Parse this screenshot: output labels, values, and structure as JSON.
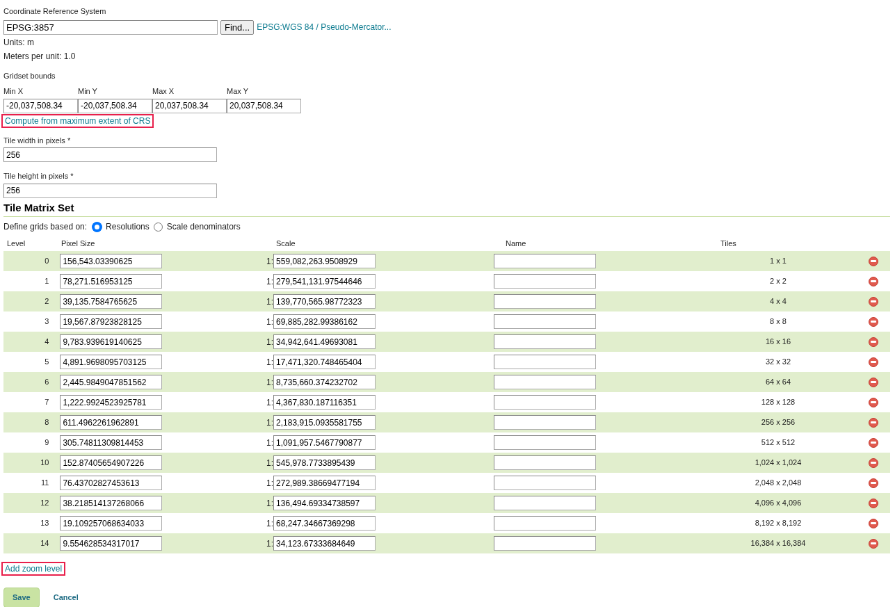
{
  "crs": {
    "label": "Coordinate Reference System",
    "value": "EPSG:3857",
    "find_button": "Find...",
    "crs_link": "EPSG:WGS 84 / Pseudo-Mercator...",
    "units": "Units: m",
    "meters_per_unit": "Meters per unit: 1.0"
  },
  "bounds": {
    "label": "Gridset bounds",
    "fields": [
      {
        "label": "Min X",
        "value": "-20,037,508.34"
      },
      {
        "label": "Min Y",
        "value": "-20,037,508.34"
      },
      {
        "label": "Max X",
        "value": "20,037,508.34"
      },
      {
        "label": "Max Y",
        "value": "20,037,508.34"
      }
    ],
    "compute_link": {
      "text": "Compute from maximum extent of CRS",
      "highlighted": true
    }
  },
  "tile_width": {
    "label": "Tile width in pixels *",
    "value": "256"
  },
  "tile_height": {
    "label": "Tile height in pixels *",
    "value": "256"
  },
  "matrix": {
    "title": "Tile Matrix Set",
    "define_label": "Define grids based on:",
    "options": [
      {
        "label": "Resolutions",
        "selected": true
      },
      {
        "label": "Scale denominators",
        "selected": false
      }
    ],
    "columns": [
      "Level",
      "Pixel Size",
      "Scale",
      "Name",
      "Tiles"
    ],
    "rows": [
      {
        "level": "0",
        "pixel_size": "156,543.03390625",
        "scale_prefix": "1:",
        "scale": "559,082,263.9508929",
        "tiles": "1 x 1"
      },
      {
        "level": "1",
        "pixel_size": "78,271.516953125",
        "scale_prefix": "1:",
        "scale": "279,541,131.97544646",
        "tiles": "2 x 2"
      },
      {
        "level": "2",
        "pixel_size": "39,135.7584765625",
        "scale_prefix": "1:",
        "scale": "139,770,565.98772323",
        "tiles": "4 x 4"
      },
      {
        "level": "3",
        "pixel_size": "19,567.87923828125",
        "scale_prefix": "1:",
        "scale": "69,885,282.99386162",
        "tiles": "8 x 8"
      },
      {
        "level": "4",
        "pixel_size": "9,783.939619140625",
        "scale_prefix": "1:",
        "scale": "34,942,641.49693081",
        "tiles": "16 x 16"
      },
      {
        "level": "5",
        "pixel_size": "4,891.9698095703125",
        "scale_prefix": "1:",
        "scale": "17,471,320.748465404",
        "tiles": "32 x 32"
      },
      {
        "level": "6",
        "pixel_size": "2,445.9849047851562",
        "scale_prefix": "1:",
        "scale": "8,735,660.374232702",
        "tiles": "64 x 64"
      },
      {
        "level": "7",
        "pixel_size": "1,222.9924523925781",
        "scale_prefix": "1:",
        "scale": "4,367,830.187116351",
        "tiles": "128 x 128"
      },
      {
        "level": "8",
        "pixel_size": "611.4962261962891",
        "scale_prefix": "1:",
        "scale": "2,183,915.0935581755",
        "tiles": "256 x 256"
      },
      {
        "level": "9",
        "pixel_size": "305.74811309814453",
        "scale_prefix": "1:",
        "scale": "1,091,957.5467790877",
        "tiles": "512 x 512"
      },
      {
        "level": "10",
        "pixel_size": "152.87405654907226",
        "scale_prefix": "1:",
        "scale": "545,978.7733895439",
        "tiles": "1,024 x 1,024"
      },
      {
        "level": "11",
        "pixel_size": "76.43702827453613",
        "scale_prefix": "1:",
        "scale": "272,989.38669477194",
        "tiles": "2,048 x 2,048"
      },
      {
        "level": "12",
        "pixel_size": "38.218514137268066",
        "scale_prefix": "1:",
        "scale": "136,494.69334738597",
        "tiles": "4,096 x 4,096"
      },
      {
        "level": "13",
        "pixel_size": "19.109257068634033",
        "scale_prefix": "1:",
        "scale": "68,247.34667369298",
        "tiles": "8,192 x 8,192"
      },
      {
        "level": "14",
        "pixel_size": "9.554628534317017",
        "scale_prefix": "1:",
        "scale": "34,123.67333684649",
        "tiles": "16,384 x 16,384"
      }
    ],
    "add_link": {
      "text": "Add zoom level",
      "highlighted": true
    }
  },
  "actions": {
    "save": "Save",
    "cancel": "Cancel"
  }
}
